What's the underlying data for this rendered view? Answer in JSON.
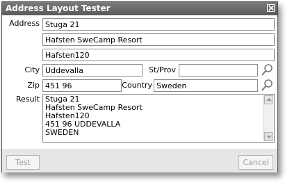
{
  "window": {
    "title": "Address Layout Tester"
  },
  "labels": {
    "address": "Address",
    "city": "City",
    "st_prov": "St/Prov",
    "zip": "Zip",
    "country": "Country",
    "result": "Result"
  },
  "fields": {
    "address_line1": "Stuga 21",
    "address_line2": "Hafsten SweCamp Resort",
    "address_line3": "Hafsten120",
    "city": "Uddevalla",
    "st_prov": "",
    "zip": "451 96",
    "country": "Sweden"
  },
  "result_text": "Stuga 21\nHafsten SweCamp Resort\nHafsten120\n451 96 UDDEVALLA\nSWEDEN",
  "buttons": {
    "test": "Test",
    "cancel": "Cancel"
  },
  "icons": {
    "lookup": "magnifier-icon",
    "close": "close-icon"
  }
}
